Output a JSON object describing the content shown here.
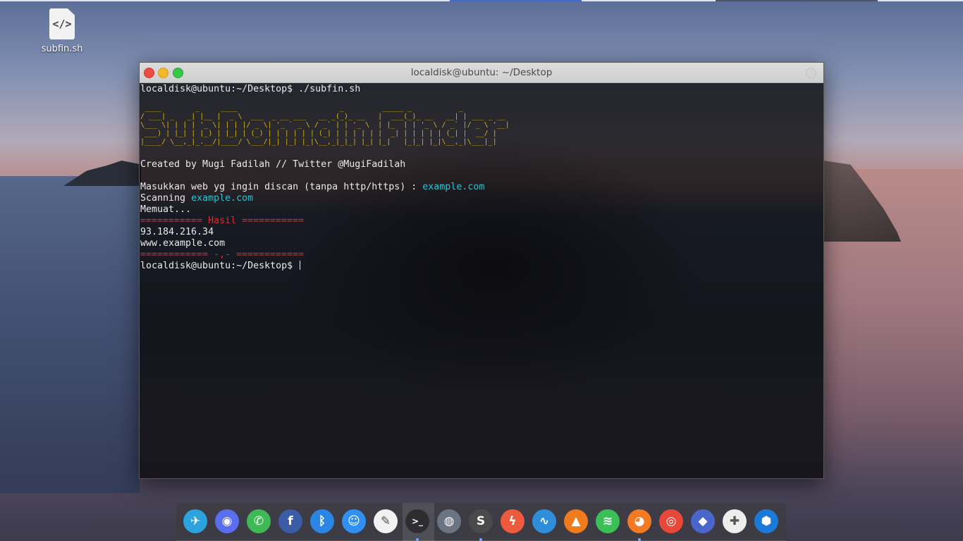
{
  "desktop": {
    "icon": {
      "label": "subfin.sh",
      "glyph": "</>"
    }
  },
  "window": {
    "title": "localdisk@ubuntu: ~/Desktop"
  },
  "terminal": {
    "cmd_line": "localdisk@ubuntu:~/Desktop$ ./subfin.sh",
    "banner": " ____        _     ____                        _         _____ _           _            \n/ ___| _   _| |__ |  _ \\  ___  _ __ ___   __ _(_)_ __   |  ___(_)_ __   __| | ___ _ __ \n\\___ \\| | | | '_ \\| | | |/ _ \\| '_ ` _ \\ / _` | | '_ \\  | |_  | | '_ \\ / _` |/ _ \\ '__|\n ___) | |_| | |_) | |_| | (_) | | | | | | (_| | | | | | |  _| | | | | | (_| |  __/ |   \n|____/ \\__,_|_.__/|____/ \\___/|_| |_| |_|\\__,_|_|_| |_| |_|   |_|_| |_|\\__,_|\\___|_|   ",
    "credit": "Created by Mugi Fadilah // Twitter @MugiFadilah",
    "prompt_text": "Masukkan web yg ingin discan (tanpa http/https) : ",
    "input_value": "example.com",
    "scanning_text": "Scanning ",
    "scanning_value": "example.com",
    "loading": "Memuat...",
    "result_header": "=========== Hasil ===========",
    "results": [
      "93.184.216.34",
      "www.example.com"
    ],
    "result_footer": "============ -,- ============",
    "final_prompt": "localdisk@ubuntu:~/Desktop$ "
  },
  "dock": {
    "items": [
      {
        "name": "telegram-icon",
        "glyph": "✈",
        "color": "#2aa3de"
      },
      {
        "name": "discord-icon",
        "glyph": "◉",
        "color": "#5a6ef0"
      },
      {
        "name": "whatsapp-icon",
        "glyph": "✆",
        "color": "#3fb956"
      },
      {
        "name": "facebook-icon",
        "glyph": "f",
        "color": "#3b5ba7"
      },
      {
        "name": "bluetooth-icon",
        "glyph": "ᛒ",
        "color": "#2b86e3"
      },
      {
        "name": "finder-icon",
        "glyph": "☺",
        "color": "#2f8ff2"
      },
      {
        "name": "text-editor-icon",
        "glyph": "✎",
        "color": "#f2f2f2"
      },
      {
        "name": "terminal-icon",
        "glyph": ">_",
        "color": "#2e2e30"
      },
      {
        "name": "download-globe-icon",
        "glyph": "◍",
        "color": "#6a7482"
      },
      {
        "name": "sublime-text-icon",
        "glyph": "S",
        "color": "#4a4a4c"
      },
      {
        "name": "flash-icon",
        "glyph": "ϟ",
        "color": "#ee5a3d"
      },
      {
        "name": "wireshark-icon",
        "glyph": "∿",
        "color": "#2f8ed9"
      },
      {
        "name": "vlc-icon",
        "glyph": "▲",
        "color": "#ef7b1c"
      },
      {
        "name": "spotify-icon",
        "glyph": "≋",
        "color": "#3bbf56"
      },
      {
        "name": "firefox-icon",
        "glyph": "◕",
        "color": "#f17a23"
      },
      {
        "name": "chrome-icon",
        "glyph": "◎",
        "color": "#e8473a"
      },
      {
        "name": "gamepad-icon",
        "glyph": "◆",
        "color": "#4b66c9"
      },
      {
        "name": "playstation-icon",
        "glyph": "✚",
        "color": "#eeeeee"
      },
      {
        "name": "helmet-icon",
        "glyph": "⬢",
        "color": "#1b7ad8"
      }
    ]
  }
}
